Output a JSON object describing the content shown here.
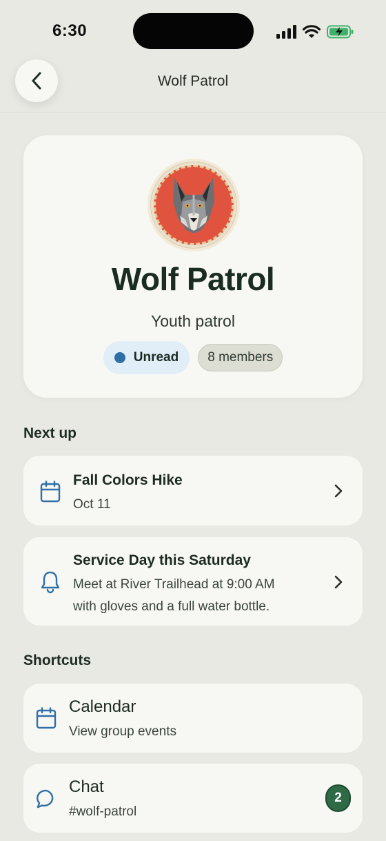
{
  "status_bar": {
    "time": "6:30"
  },
  "nav": {
    "title": "Wolf Patrol"
  },
  "hero": {
    "title": "Wolf Patrol",
    "subtitle": "Youth patrol",
    "unread_label": "Unread",
    "members_label": "8 members"
  },
  "next_up": {
    "heading": "Next up",
    "items": [
      {
        "title": "Fall Colors Hike",
        "detail": "Oct 11",
        "icon": "calendar-icon"
      },
      {
        "title": "Service Day this Saturday",
        "detail_line1": "Meet at River Trailhead at 9:00 AM",
        "detail_line2": "with gloves and a full water bottle.",
        "icon": "bell-icon"
      }
    ]
  },
  "shortcuts": {
    "heading": "Shortcuts",
    "items": [
      {
        "title": "Calendar",
        "subtitle": "View group events",
        "icon": "calendar-icon"
      },
      {
        "title": "Chat",
        "subtitle": "#wolf-patrol",
        "badge": "2",
        "icon": "chat-bubble-icon"
      }
    ]
  },
  "colors": {
    "accent": "#2f6fa6",
    "badge_green": "#2e6a46",
    "patch_red": "#e0533f"
  }
}
